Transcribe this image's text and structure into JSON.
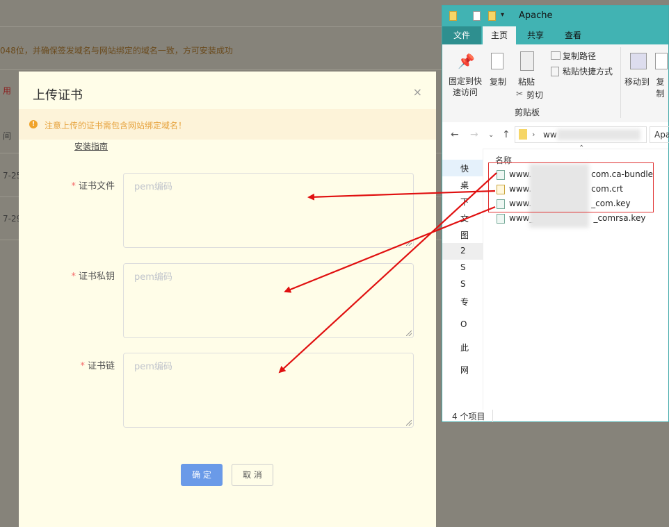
{
  "background": {
    "notice_text": "048位，并确保签发域名与网站绑定的域名一致，方可安装成功",
    "side_label_1": "用",
    "side_label_2": "间",
    "date_1": "7-25",
    "date_2": "7-29"
  },
  "dialog": {
    "title": "上传证书",
    "close_icon": "×",
    "notice": "注意上传的证书需包含网站绑定域名！",
    "guide_link": "安装指南",
    "fields": [
      {
        "label": "证书文件",
        "placeholder": "pem编码"
      },
      {
        "label": "证书私钥",
        "placeholder": "pem编码"
      },
      {
        "label": "证书链",
        "placeholder": "pem编码"
      }
    ],
    "ok_label": "确 定",
    "cancel_label": "取 消"
  },
  "explorer": {
    "title": "Apache",
    "tabs": [
      "文件",
      "主页",
      "共享",
      "查看"
    ],
    "ribbon": {
      "pin_label": "固定到快\n速访问",
      "copy_label": "复制",
      "paste_label": "粘贴",
      "copy_path": "复制路径",
      "paste_shortcut": "粘贴快捷方式",
      "cut_label": "剪切",
      "clipboard_group": "剪贴板",
      "move_to": "移动到",
      "copy_to": "复制"
    },
    "address": {
      "prefix": "ww",
      "right_text": "Apa"
    },
    "column_header": "名称",
    "nav_items": [
      "快",
      "桌",
      "下",
      "文",
      "图",
      "2",
      "S",
      "S",
      "专",
      "O",
      "此",
      "网"
    ],
    "files": [
      {
        "prefix": "www.",
        "suffix": "com.ca-bundle"
      },
      {
        "prefix": "www.",
        "suffix": "com.crt"
      },
      {
        "prefix": "www.",
        "suffix": "_com.key"
      },
      {
        "prefix": "www_",
        "suffix": "_comrsa.key"
      }
    ],
    "status": "4 个项目"
  },
  "colors": {
    "accent_button": "#6a9ae8",
    "warning": "#e6a23c",
    "titlebar": "#41b3b3",
    "arrow": "#e01010"
  }
}
